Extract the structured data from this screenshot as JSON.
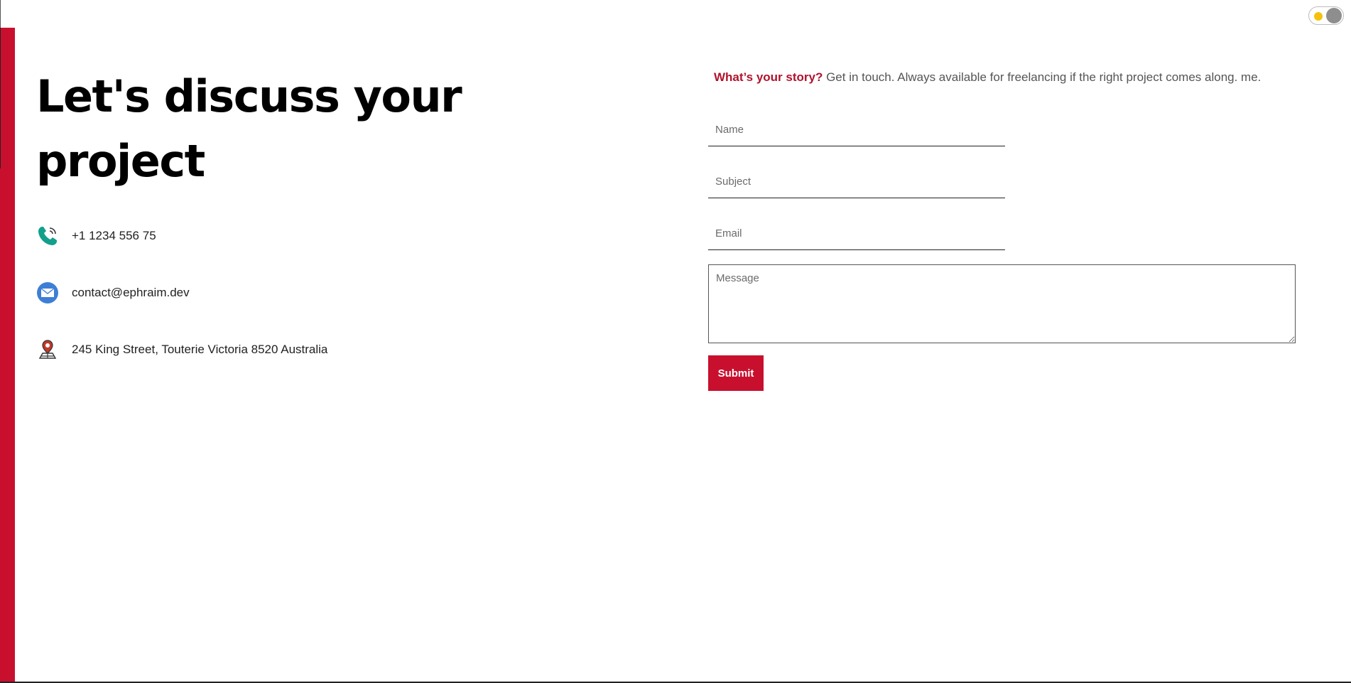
{
  "page": {
    "heading": "Let's discuss your project"
  },
  "theme_toggle": {
    "icon": "sun-icon"
  },
  "contacts": [
    {
      "icon": "phone-icon",
      "text": "+1 1234 556 75"
    },
    {
      "icon": "mail-icon",
      "text": "contact@ephraim.dev"
    },
    {
      "icon": "map-pin-icon",
      "text": "245 King Street, Touterie Victoria 8520 Australia"
    }
  ],
  "form": {
    "intro_strong": "What’s your story?",
    "intro_text": " Get in touch. Always available for freelancing if the right project comes along. me.",
    "name_placeholder": "Name",
    "subject_placeholder": "Subject",
    "email_placeholder": "Email",
    "message_placeholder": "Message",
    "submit_label": "Submit"
  },
  "colors": {
    "accent": "#c8102e",
    "accent_text": "#b0132c",
    "phone_icon": "#12a08c",
    "mail_icon": "#3d7fd6",
    "pin_icon": "#c0392b"
  }
}
